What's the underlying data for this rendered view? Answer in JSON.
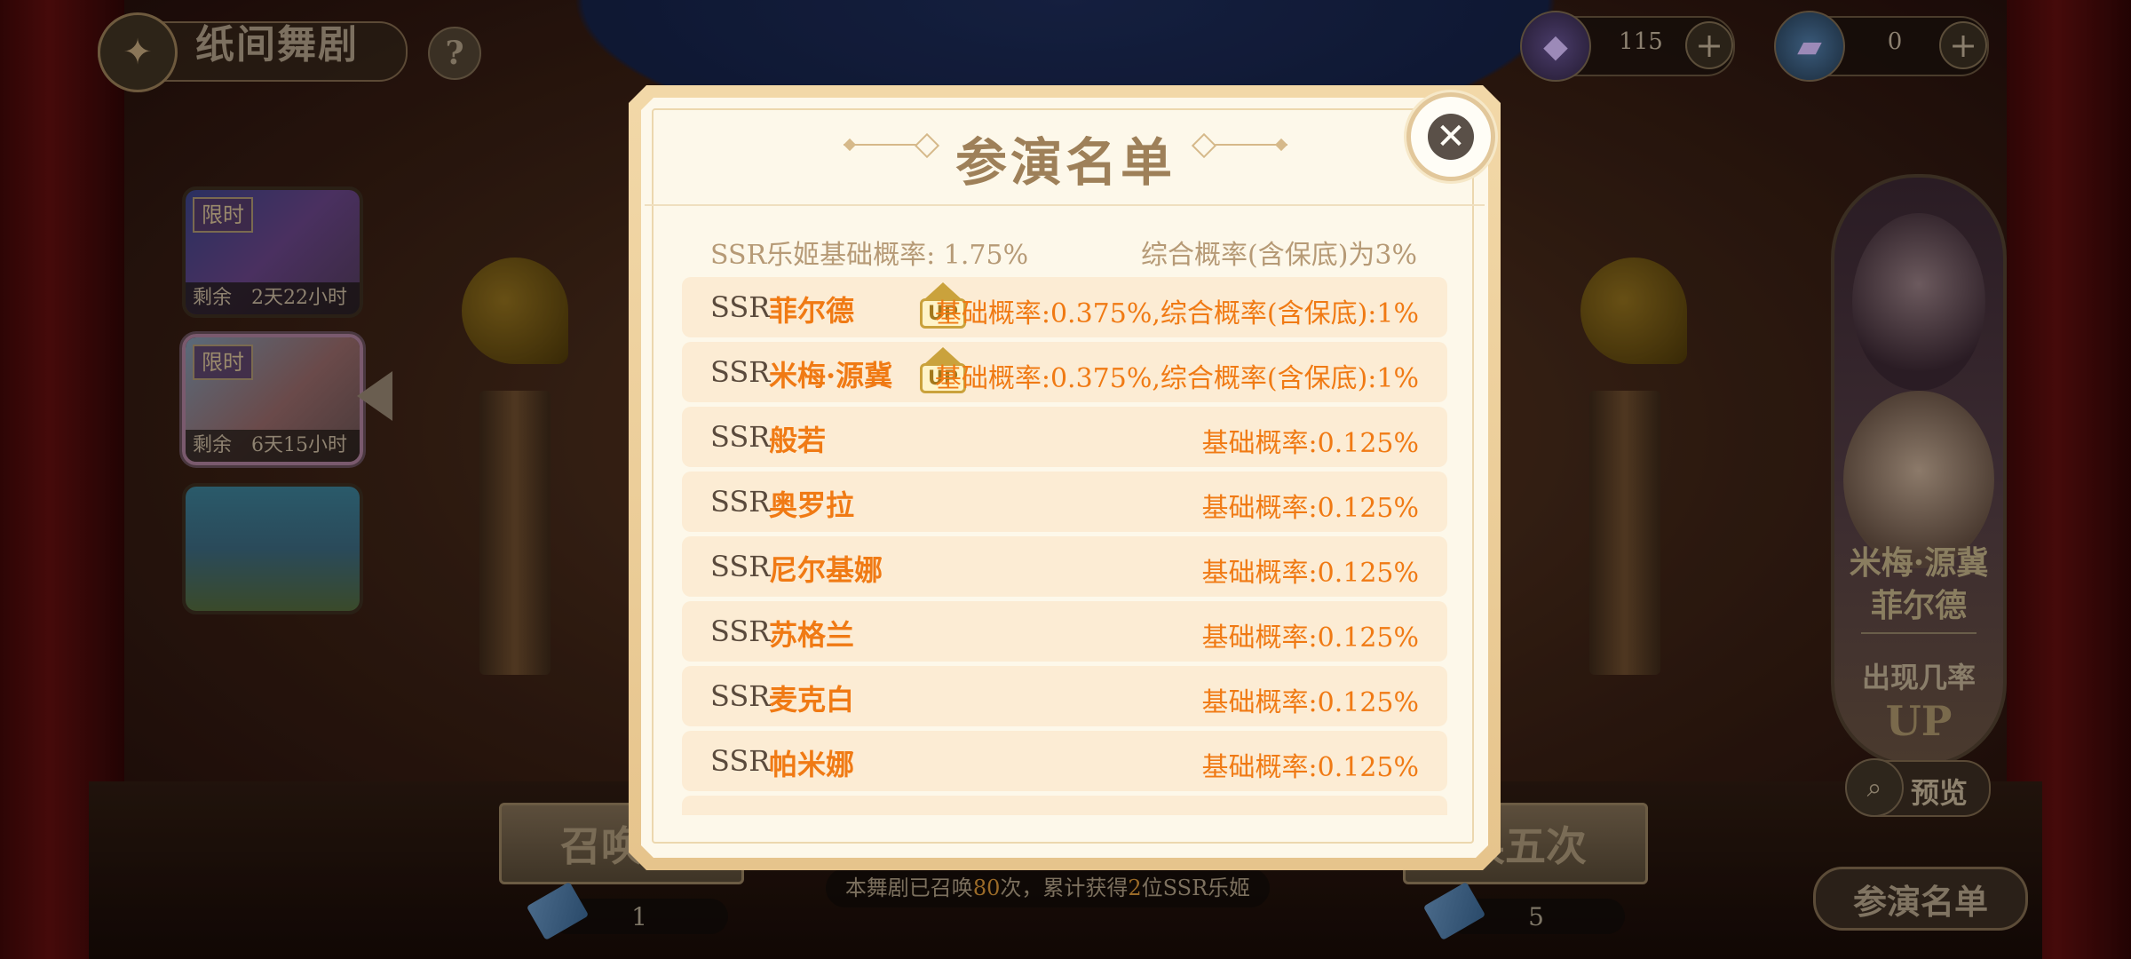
{
  "header": {
    "title": "纸间舞剧",
    "help_label": "?",
    "gems": {
      "value": "115",
      "plus": "+",
      "icon": "gem-icon"
    },
    "tickets": {
      "value": "0",
      "plus": "+",
      "icon": "ticket-icon"
    }
  },
  "banners": [
    {
      "tag": "限时",
      "remaining": "剩余　2天22小时"
    },
    {
      "tag": "限时",
      "remaining": "剩余　6天15小时"
    },
    {
      "tag": "",
      "remaining": ""
    }
  ],
  "portrait": {
    "names": "米梅·源冀\n菲尔德",
    "appear_label": "出现几率",
    "up_label": "UP",
    "preview_label": "预览"
  },
  "bottom": {
    "summon_once": "召唤一",
    "summon_five": "唤五次",
    "cost_once": "1",
    "cost_five": "5",
    "stats_prefix": "本舞剧已召唤",
    "stats_count": "80",
    "stats_mid": "次，累计获得",
    "stats_ssr": "2",
    "stats_suffix": "位SSR乐姬",
    "cast_button": "参演名单"
  },
  "modal": {
    "title": "参演名单",
    "close_icon": "close-icon",
    "base_rate": "SSR乐姬基础概率: 1.75%",
    "overall_rate": "综合概率(含保底)为3%",
    "rows": [
      {
        "rarity": "SSR",
        "name": "菲尔德",
        "up": true,
        "up_label": "UP",
        "rate": "基础概率:0.375%,综合概率(含保底):1%"
      },
      {
        "rarity": "SSR",
        "name": "米梅·源冀",
        "up": true,
        "up_label": "UP",
        "rate": "基础概率:0.375%,综合概率(含保底):1%"
      },
      {
        "rarity": "SSR",
        "name": "般若",
        "up": false,
        "rate": "基础概率:0.125%"
      },
      {
        "rarity": "SSR",
        "name": "奥罗拉",
        "up": false,
        "rate": "基础概率:0.125%"
      },
      {
        "rarity": "SSR",
        "name": "尼尔基娜",
        "up": false,
        "rate": "基础概率:0.125%"
      },
      {
        "rarity": "SSR",
        "name": "苏格兰",
        "up": false,
        "rate": "基础概率:0.125%"
      },
      {
        "rarity": "SSR",
        "name": "麦克白",
        "up": false,
        "rate": "基础概率:0.125%"
      },
      {
        "rarity": "SSR",
        "name": "帕米娜",
        "up": false,
        "rate": "基础概率:0.125%"
      }
    ]
  }
}
